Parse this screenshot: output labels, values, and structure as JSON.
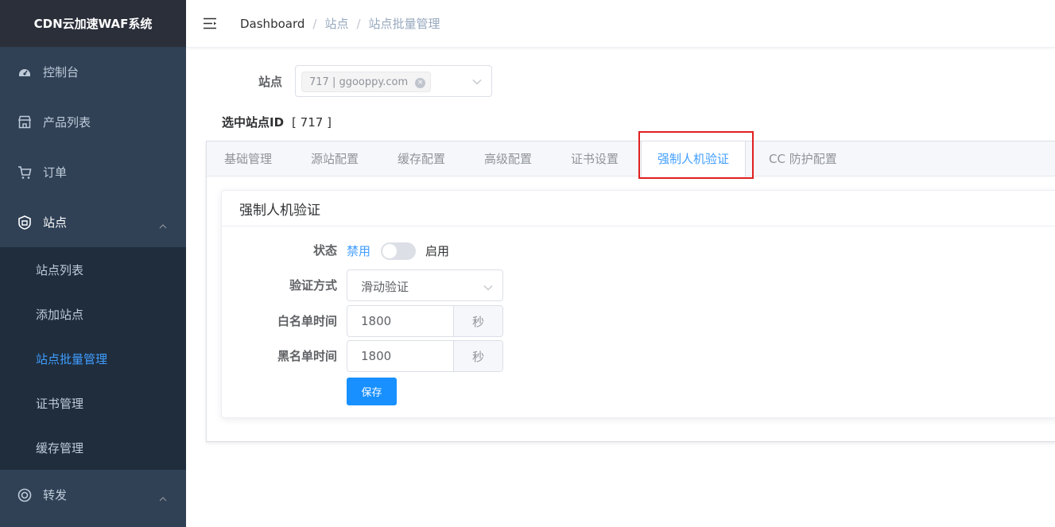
{
  "app": {
    "title": "CDN云加速WAF系统"
  },
  "sidebar": {
    "items": [
      {
        "label": "控制台",
        "icon": "dashboard-icon"
      },
      {
        "label": "产品列表",
        "icon": "store-icon"
      },
      {
        "label": "订单",
        "icon": "cart-icon"
      },
      {
        "label": "站点",
        "icon": "site-icon",
        "expanded": true
      },
      {
        "label": "转发",
        "icon": "forward-icon",
        "expanded": true
      }
    ],
    "site_submenu": [
      {
        "label": "站点列表"
      },
      {
        "label": "添加站点"
      },
      {
        "label": "站点批量管理",
        "active": true
      },
      {
        "label": "证书管理"
      },
      {
        "label": "缓存管理"
      }
    ]
  },
  "header": {
    "breadcrumb": [
      "Dashboard",
      "站点",
      "站点批量管理"
    ],
    "separator": "/"
  },
  "site_select": {
    "label": "站点",
    "tag": "717 | ggooppy.com"
  },
  "selected": {
    "label": "选中站点ID",
    "value": "[ 717 ]"
  },
  "tabs": [
    {
      "label": "基础管理"
    },
    {
      "label": "源站配置"
    },
    {
      "label": "缓存配置"
    },
    {
      "label": "高级配置"
    },
    {
      "label": "证书设置"
    },
    {
      "label": "强制人机验证",
      "active": true
    },
    {
      "label": "CC 防护配置"
    }
  ],
  "panel": {
    "title": "强制人机验证",
    "status_label": "状态",
    "status_off": "禁用",
    "status_on": "启用",
    "status_enabled": false,
    "method_label": "验证方式",
    "method_value": "滑动验证",
    "whitelist_label": "白名单时间",
    "whitelist_value": "1800",
    "whitelist_unit": "秒",
    "blacklist_label": "黑名单时间",
    "blacklist_value": "1800",
    "blacklist_unit": "秒",
    "save_label": "保存"
  },
  "colors": {
    "sidebar_bg": "#304156",
    "submenu_bg": "#1f2d3d",
    "brand_bg": "#2b2f3a",
    "accent": "#409eff",
    "button": "#1890ff",
    "highlight_box": "#e02020"
  }
}
